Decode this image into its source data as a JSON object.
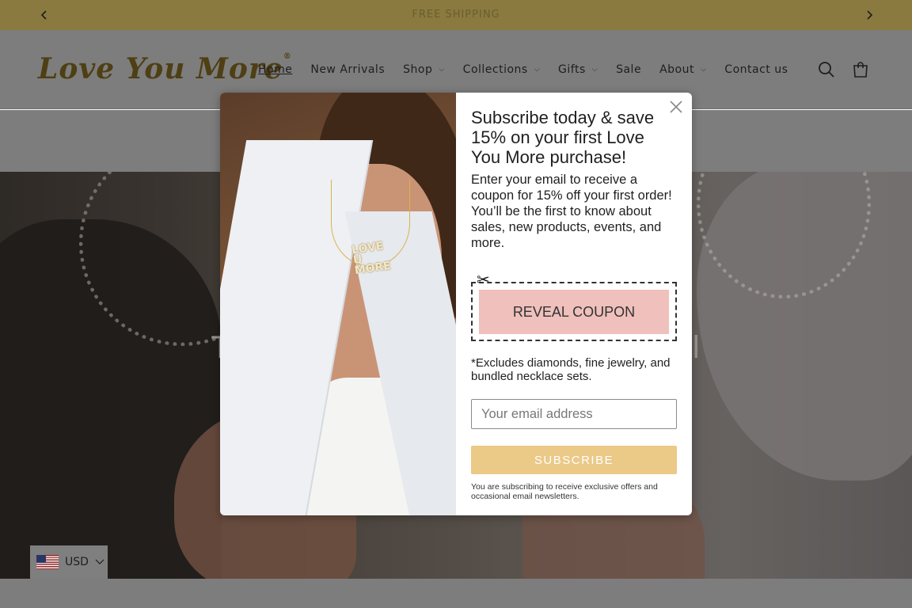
{
  "announcement": {
    "message": "FREE SHIPPING",
    "prev_icon": "chevron-left-icon",
    "next_icon": "chevron-right-icon"
  },
  "header": {
    "logo_text": "Love You More",
    "logo_mark": "®",
    "nav": [
      {
        "label": "Home",
        "has_dropdown": false,
        "active": true
      },
      {
        "label": "New Arrivals",
        "has_dropdown": false
      },
      {
        "label": "Shop",
        "has_dropdown": true
      },
      {
        "label": "Collections",
        "has_dropdown": true
      },
      {
        "label": "Gifts",
        "has_dropdown": true
      },
      {
        "label": "Sale",
        "has_dropdown": false
      },
      {
        "label": "About",
        "has_dropdown": true
      },
      {
        "label": "Contact us",
        "has_dropdown": false
      }
    ],
    "search_icon": "search-icon",
    "cart_icon": "cart-icon"
  },
  "hero": {
    "title": "The                                    tiful"
  },
  "currency": {
    "code": "USD",
    "flag": "us-flag-icon"
  },
  "popup": {
    "title": "Subscribe today & save 15% on your first Love You More purchase!",
    "description": "Enter your email to receive a coupon for 15% off your first order! You’ll be the first to know about sales, new products, events, and more.",
    "coupon_button": "REVEAL COUPON",
    "exclusions": "*Excludes diamonds, fine jewelry, and bundled necklace sets.",
    "email_placeholder": "Your email address",
    "subscribe_button": "SUBSCRIBE",
    "fine_print": "You are subscribing to receive exclusive offers and occasional email newsletters.",
    "pendant_text": "LOVE U MORE"
  },
  "colors": {
    "accent_gold": "#ebc987",
    "coupon_pink": "#efc0bc",
    "announcement_bg": "#8a7a3f",
    "overlay_gray": "#7d7d7d"
  }
}
